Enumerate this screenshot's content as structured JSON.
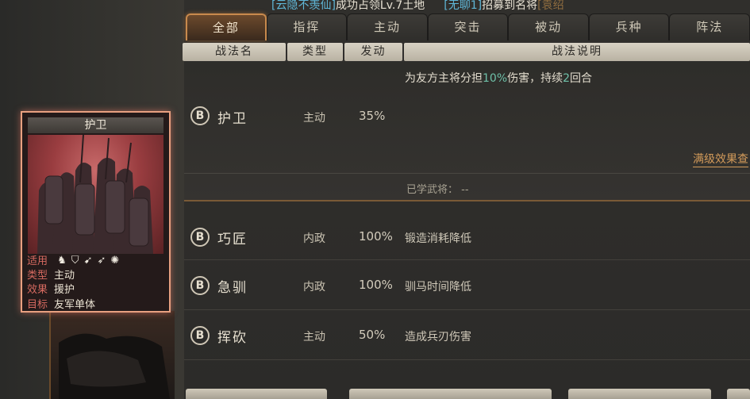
{
  "ticker": {
    "player1": "[云隐不羡仙]",
    "event1": "成功占领Lv.7土地",
    "player2": "[无聊1]",
    "event2": "招募到名将",
    "tail": "[袁绍"
  },
  "tabs": [
    {
      "label": "全部",
      "active": true
    },
    {
      "label": "指挥",
      "active": false
    },
    {
      "label": "主动",
      "active": false
    },
    {
      "label": "突击",
      "active": false
    },
    {
      "label": "被动",
      "active": false
    },
    {
      "label": "兵种",
      "active": false
    },
    {
      "label": "阵法",
      "active": false
    }
  ],
  "columns": {
    "name": "战法名",
    "type": "类型",
    "trigger": "发动",
    "desc": "战法说明"
  },
  "expanded": {
    "grade": "B",
    "name": "护卫",
    "type": "主动",
    "rate": "35%",
    "desc_pre": "为友方主将分担",
    "desc_hl": "10%",
    "desc_mid": "伤害，持续",
    "desc_hl2": "2",
    "desc_post": "回合",
    "full_effect": "满级效果查",
    "learned_label": "已学武将：",
    "learned_value": "--"
  },
  "rows": [
    {
      "grade": "B",
      "name": "巧匠",
      "type": "内政",
      "rate": "100%",
      "desc": "锻造消耗降低"
    },
    {
      "grade": "B",
      "name": "急驯",
      "type": "内政",
      "rate": "100%",
      "desc": "驯马时间降低"
    },
    {
      "grade": "B",
      "name": "挥砍",
      "type": "主动",
      "rate": "50%",
      "desc": "造成兵刃伤害"
    }
  ],
  "card": {
    "title": "护卫",
    "apply_label": "适用",
    "type_label": "类型",
    "type_value": "主动",
    "effect_label": "效果",
    "effect_value": "援护",
    "target_label": "目标",
    "target_value": "友军单体",
    "unit_icons": [
      "cavalry-icon",
      "shield-icon",
      "bow-icon",
      "spear-icon",
      "wheel-icon"
    ]
  },
  "colors": {
    "accent": "#c88a4d",
    "highlight": "#6ec0a8",
    "card_border": "#e8a080",
    "label_red": "#d66a60"
  }
}
